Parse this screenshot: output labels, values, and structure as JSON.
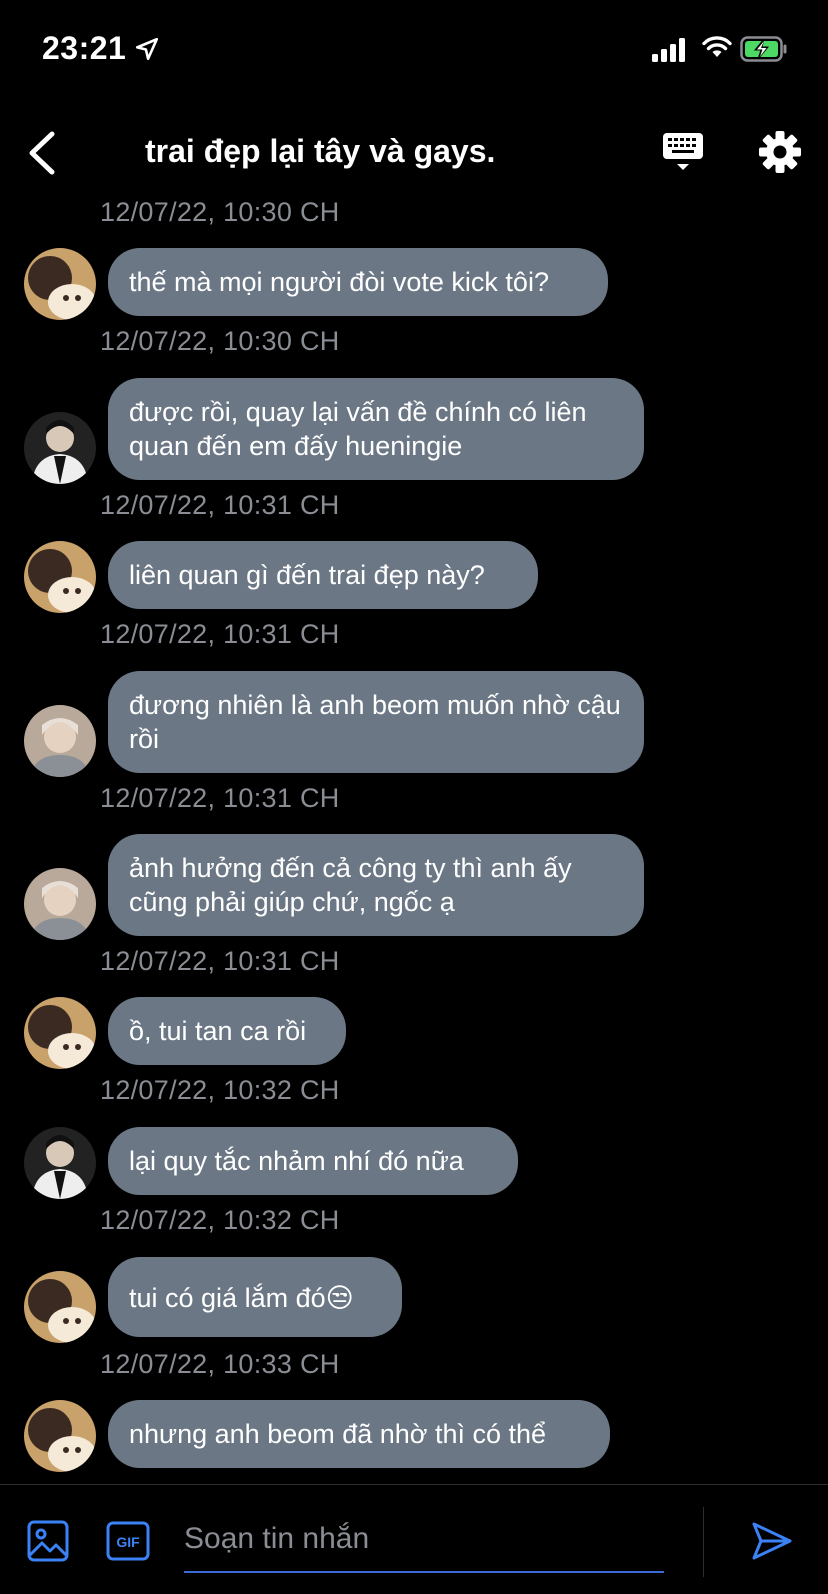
{
  "status_bar": {
    "time": "23:21"
  },
  "header": {
    "title": "trai đẹp lại tây và gays."
  },
  "top_timestamp": "12/07/22, 10:30 CH",
  "messages": [
    {
      "avatar": "avatar-a",
      "text": "thế mà mọi người đòi vote kick tôi?",
      "time": "12/07/22, 10:30 CH"
    },
    {
      "avatar": "avatar-b",
      "text": "được rồi, quay lại vấn đề chính có liên quan đến em đấy hueningie",
      "time": "12/07/22, 10:31 CH"
    },
    {
      "avatar": "avatar-a",
      "text": "liên quan gì đến trai đẹp này?",
      "time": "12/07/22, 10:31 CH"
    },
    {
      "avatar": "avatar-c",
      "text": "đương nhiên là anh beom muốn nhờ cậu rồi",
      "time": "12/07/22, 10:31 CH"
    },
    {
      "avatar": "avatar-c",
      "text": "ảnh hưởng đến cả công ty thì anh ấy cũng phải giúp chứ, ngốc ạ",
      "time": "12/07/22, 10:31 CH"
    },
    {
      "avatar": "avatar-a",
      "text": "ồ, tui tan ca rồi",
      "time": "12/07/22, 10:32 CH"
    },
    {
      "avatar": "avatar-b",
      "text": "lại quy tắc nhảm nhí đó nữa",
      "time": "12/07/22, 10:32 CH"
    },
    {
      "avatar": "avatar-a",
      "text": "tui có giá lắm đó😒",
      "time": "12/07/22, 10:33 CH"
    },
    {
      "avatar": "avatar-a",
      "text": "nhưng anh beom đã nhờ thì có thể",
      "time": ""
    }
  ],
  "composer": {
    "placeholder": "Soạn tin nhắn",
    "gif_label": "GIF"
  },
  "colors": {
    "bubble": "#6b7785",
    "accent": "#3b6bd6",
    "timestamp": "#8a8d93"
  }
}
